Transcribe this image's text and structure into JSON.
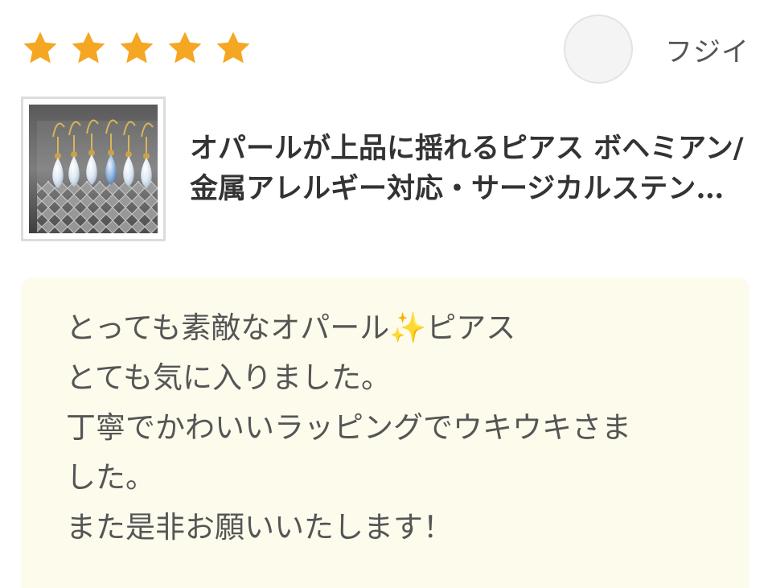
{
  "review": {
    "rating": 5,
    "rating_max": 5,
    "star_color": "#f5a623",
    "reviewer": {
      "name": "フジイ"
    },
    "product": {
      "title": "オパールが上品に揺れるピアス ボヘミアン/金属アレルギー対応・サージカルステンレス",
      "thumbnail_icon": "opal-earrings-photo"
    },
    "comment": {
      "lines": [
        "とっても素敵なオパール✨ピアス",
        "とても気に入りました。",
        "丁寧でかわいいラッピングでウキウキさま",
        "した。",
        "また是非お願いいたします！"
      ],
      "background_color": "#fdfbec"
    }
  }
}
